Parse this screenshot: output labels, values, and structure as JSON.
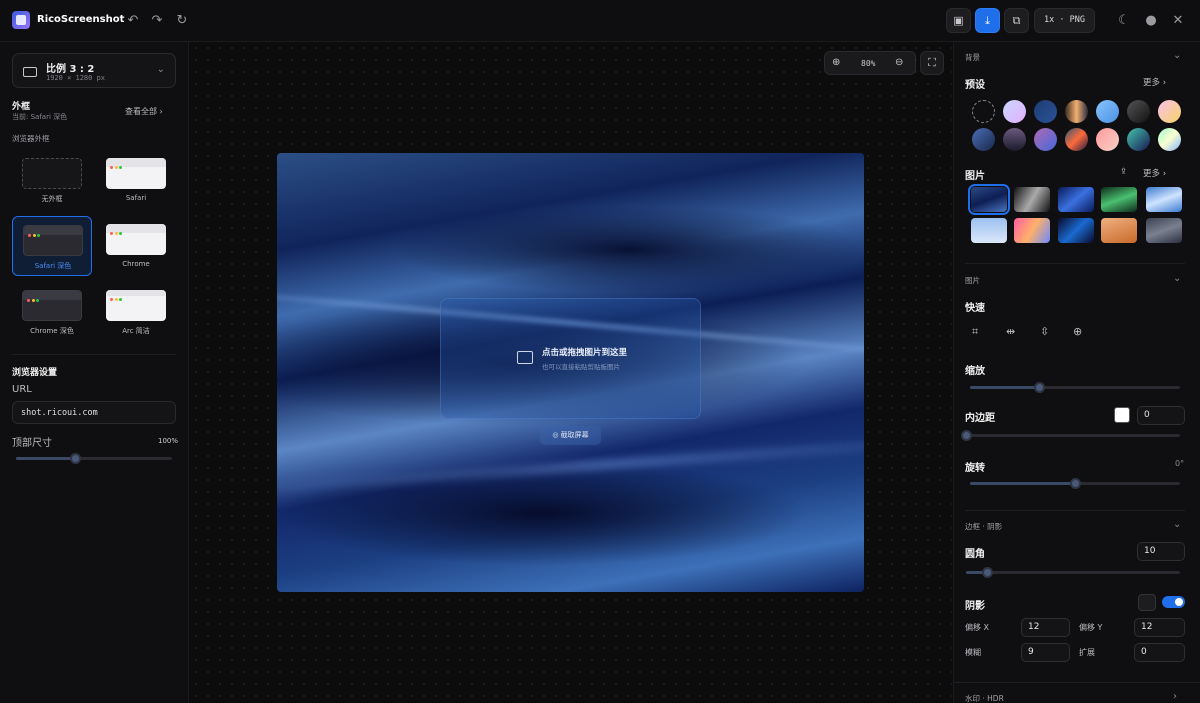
{
  "app": {
    "title": "RicoScreenshot"
  },
  "toolbar": {
    "export_format": "1x · PNG"
  },
  "left": {
    "ratio": {
      "title": "比例 3 : 2",
      "size": "1920 × 1280 px"
    },
    "frame": {
      "title": "外框",
      "current": "当前: Safari 深色",
      "view_all": "查看全部"
    },
    "browser_frames_label": "浏览器外框",
    "frames": [
      "无外框",
      "Safari",
      "Safari 深色",
      "Chrome",
      "Chrome 深色",
      "Arc 简洁"
    ],
    "browser_settings": {
      "title": "浏览器设置",
      "url_label": "URL",
      "url_value": "shot.ricoui.com",
      "top_size_label": "顶部尺寸",
      "top_size_value": "100%",
      "top_size_level": 0.38
    }
  },
  "canvas": {
    "zoom": "80%",
    "dropzone": {
      "title": "点击或拖拽图片到这里",
      "subtitle": "也可以直接粘贴剪贴板图片"
    },
    "capture_label": "截取屏幕"
  },
  "right": {
    "background_section": "背景",
    "presets_title": "预设",
    "more": "更多",
    "images_title": "图片",
    "image_section": "图片",
    "quick_title": "快速",
    "scale_title": "缩放",
    "scale_level": 0.33,
    "padding_title": "内边距",
    "padding_value": "0",
    "padding_color": "#ffffff",
    "padding_level": 0.0,
    "rotate_title": "旋转",
    "rotate_value": "0°",
    "rotate_level": 0.5,
    "border_section": "边框 · 阴影",
    "radius_title": "圆角",
    "radius_value": "10",
    "radius_level": 0.1,
    "shadow_title": "阴影",
    "shadow_enabled": true,
    "offset_x_label": "偏移 X",
    "offset_x": "12",
    "offset_y_label": "偏移 Y",
    "offset_y": "12",
    "blur_label": "模糊",
    "blur": "9",
    "spread_label": "扩展",
    "spread": "0",
    "watermark_section": "水印 · HDR"
  },
  "colors": {
    "accent": "#1f6feb"
  }
}
